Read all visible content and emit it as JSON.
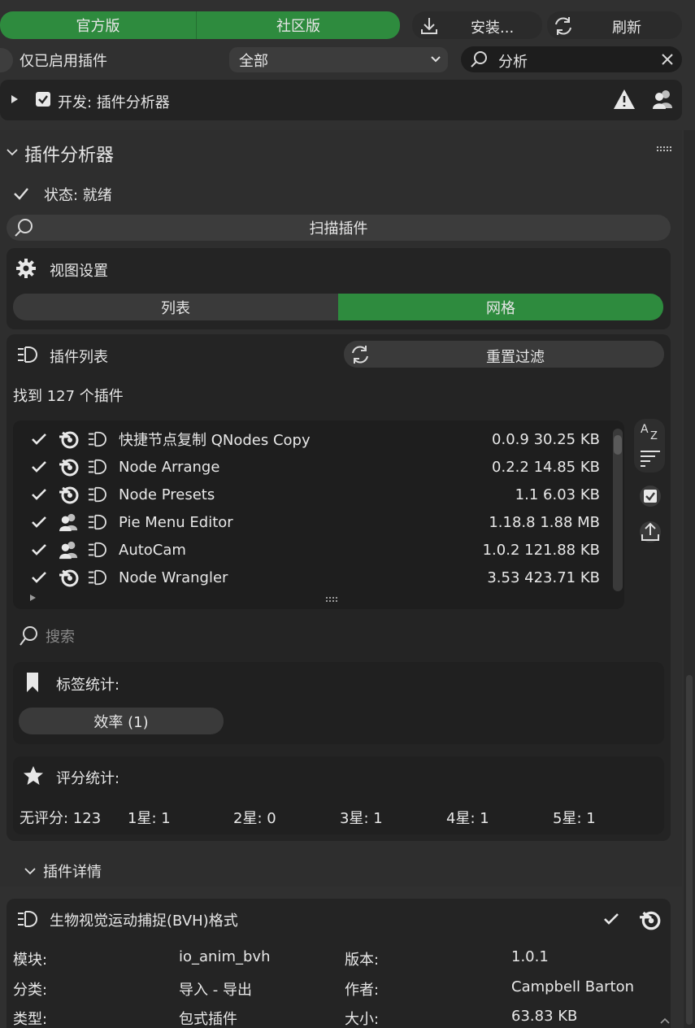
{
  "topbar": {
    "tab_official": "官方版",
    "tab_community": "社区版",
    "install_label": "安装...",
    "refresh_label": "刷新"
  },
  "filter": {
    "enabled_only_label": "仅已启用插件",
    "category_value": "全部",
    "search_value": "分析"
  },
  "addon_header": {
    "label": "开发: 插件分析器"
  },
  "analyzer": {
    "title": "插件分析器",
    "status": "状态: 就绪",
    "scan_button": "扫描插件",
    "view_settings": {
      "title": "视图设置",
      "options": [
        "列表",
        "网格"
      ],
      "selected": "网格"
    },
    "plugin_list": {
      "title": "插件列表",
      "reset_filter": "重置过滤",
      "found_text": "找到 127 个插件",
      "items": [
        {
          "name": "快捷节点复制 QNodes Copy",
          "version": "0.0.9",
          "size": "30.25 KB",
          "source_icon": "blender-icon"
        },
        {
          "name": "Node Arrange",
          "version": "0.2.2",
          "size": "14.85 KB",
          "source_icon": "blender-icon"
        },
        {
          "name": "Node Presets",
          "version": "1.1",
          "size": "6.03 KB",
          "source_icon": "blender-icon"
        },
        {
          "name": "Pie Menu Editor",
          "version": "1.18.8",
          "size": "1.88 MB",
          "source_icon": "community-icon"
        },
        {
          "name": "AutoCam",
          "version": "1.0.2",
          "size": "121.88 KB",
          "source_icon": "community-icon"
        },
        {
          "name": "Node Wrangler",
          "version": "3.53",
          "size": "423.71 KB",
          "source_icon": "blender-icon"
        }
      ],
      "search_placeholder": "搜索"
    },
    "tag_stats": {
      "title": "标签统计:",
      "tags": [
        "效率 (1)"
      ]
    },
    "rating_stats": {
      "title": "评分统计:",
      "values": [
        "无评分: 123",
        "1星: 1",
        "2星: 0",
        "3星: 1",
        "4星: 1",
        "5星: 1"
      ]
    }
  },
  "details": {
    "section_title": "插件详情",
    "plugin_name": "生物视觉运动捕捉(BVH)格式",
    "fields": {
      "module_label": "模块:",
      "module_value": "io_anim_bvh",
      "version_label": "版本:",
      "version_value": "1.0.1",
      "category_label": "分类:",
      "category_value": "导入 - 导出",
      "author_label": "作者:",
      "author_value": "Campbell Barton",
      "type_label": "类型:",
      "type_value": "包式插件",
      "size_label": "大小:",
      "size_value": "63.83 KB"
    }
  },
  "colors": {
    "accent_green": "#2e8b3e",
    "background": "#303030",
    "panel": "#2a2a2a"
  }
}
